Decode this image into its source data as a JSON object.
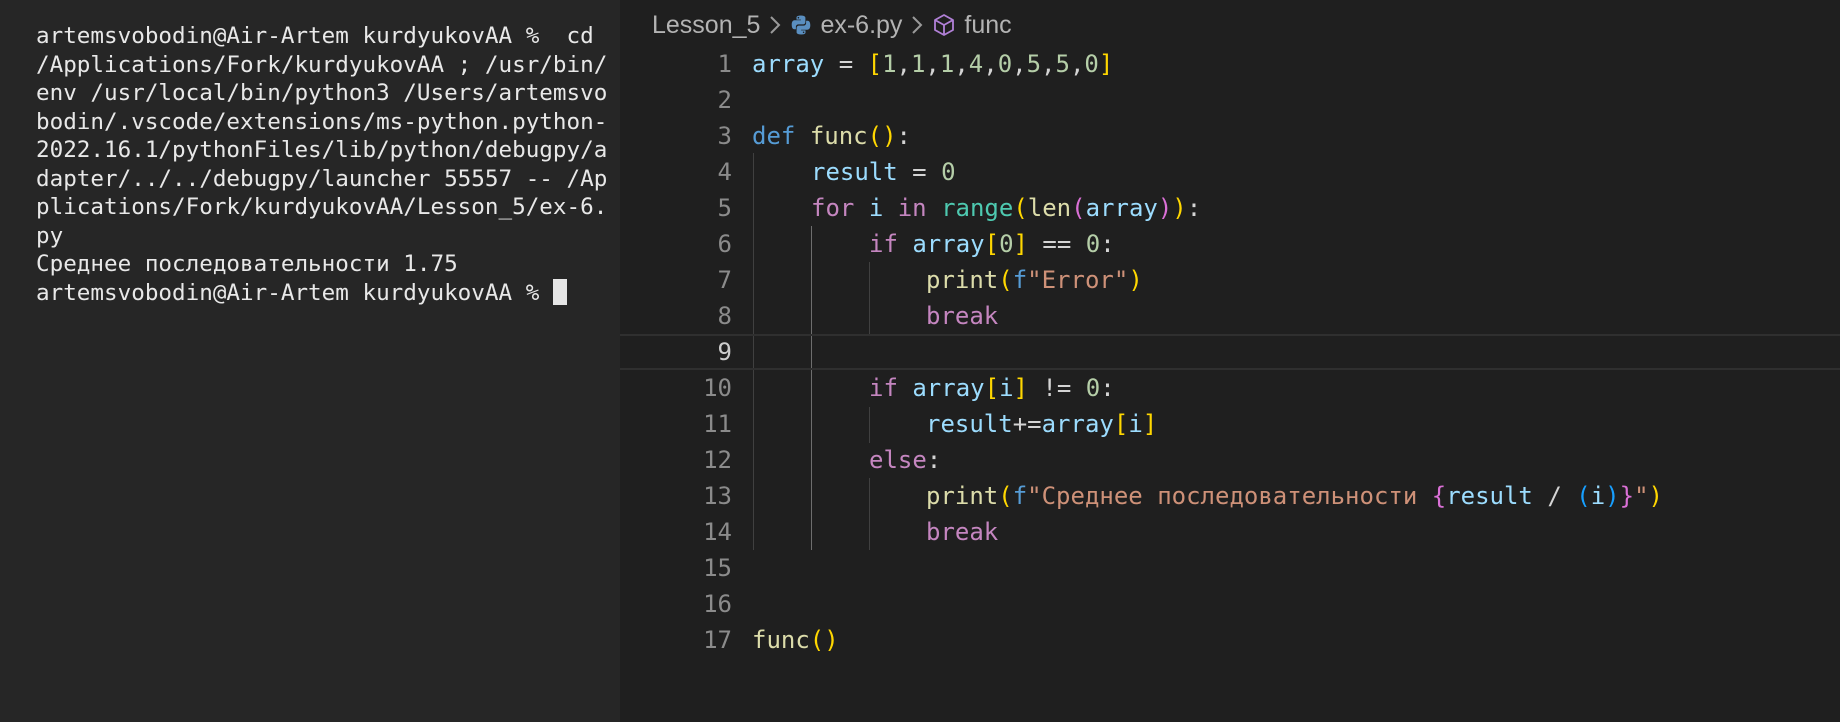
{
  "terminal": {
    "output": "artemsvobodin@Air-Artem kurdyukovAA %  cd /Applications/Fork/kurdyukovAA ; /usr/bin/env /usr/local/bin/python3 /Users/artemsvobodin/.vscode/extensions/ms-python.python-2022.16.1/pythonFiles/lib/python/debugpy/adapter/../../debugpy/launcher 55557 -- /Applications/Fork/kurdyukovAA/Lesson_5/ex-6.py\nСреднее последовательности 1.75\nartemsvobodin@Air-Artem kurdyukovAA % "
  },
  "breadcrumb": {
    "folder": "Lesson_5",
    "file": "ex-6.py",
    "symbol": "func",
    "file_icon": "python-icon",
    "symbol_icon": "symbol-method-icon",
    "separator_icon": "chevron-right-icon"
  },
  "editor": {
    "active_line": "9",
    "lines": [
      {
        "n": "1",
        "t": {
          "a": "array",
          "b": " = ",
          "c": "[",
          "d": "1",
          "e": ",",
          "f": "1",
          "g": ",",
          "h": "1",
          "i": ",",
          "j": "4",
          "k": ",",
          "l": "0",
          "m": ",",
          "n": "5",
          "o": ",",
          "p": "5",
          "q": ",",
          "r": "0",
          "s": "]"
        }
      },
      {
        "n": "2"
      },
      {
        "n": "3",
        "t": {
          "a": "def",
          "b": " ",
          "c": "func",
          "d": "(",
          "e": ")",
          "f": ":"
        }
      },
      {
        "n": "4",
        "t": {
          "a": "result",
          "b": " = ",
          "c": "0"
        }
      },
      {
        "n": "5",
        "t": {
          "a": "for",
          "b": " ",
          "c": "i",
          "d": " ",
          "e": "in",
          "f": " ",
          "g": "range",
          "h": "(",
          "i": "len",
          "j": "(",
          "k": "array",
          "l": ")",
          "m": ")",
          "n": ":"
        }
      },
      {
        "n": "6",
        "t": {
          "a": "if",
          "b": " ",
          "c": "array",
          "d": "[",
          "e": "0",
          "f": "]",
          "g": " == ",
          "h": "0",
          "i": ":"
        }
      },
      {
        "n": "7",
        "t": {
          "a": "print",
          "b": "(",
          "c": "f",
          "d": "\"Error\"",
          "e": ")"
        }
      },
      {
        "n": "8",
        "t": {
          "a": "break"
        }
      },
      {
        "n": "9"
      },
      {
        "n": "10",
        "t": {
          "a": "if",
          "b": " ",
          "c": "array",
          "d": "[",
          "e": "i",
          "f": "]",
          "g": " != ",
          "h": "0",
          "i": ":"
        }
      },
      {
        "n": "11",
        "t": {
          "a": "result",
          "b": "+=",
          "c": "array",
          "d": "[",
          "e": "i",
          "f": "]"
        }
      },
      {
        "n": "12",
        "t": {
          "a": "else",
          "b": ":"
        }
      },
      {
        "n": "13",
        "t": {
          "a": "print",
          "b": "(",
          "c": "f",
          "d": "\"Среднее последовательности ",
          "e": "{",
          "f": "result",
          "g": " / ",
          "h": "(",
          "i": "i",
          "j": ")",
          "k": "}",
          "l": "\"",
          "m": ")"
        }
      },
      {
        "n": "14",
        "t": {
          "a": "break"
        }
      },
      {
        "n": "15"
      },
      {
        "n": "16"
      },
      {
        "n": "17",
        "t": {
          "a": "func",
          "b": "(",
          "c": ")"
        }
      }
    ]
  },
  "colors": {
    "terminal_bg": "#262626",
    "editor_bg": "#1f1f1f",
    "keyword": "#c586c0",
    "def": "#569cd6",
    "function": "#dcdcaa",
    "variable": "#9cdcfe",
    "number": "#b5cea8",
    "string": "#ce9178"
  }
}
